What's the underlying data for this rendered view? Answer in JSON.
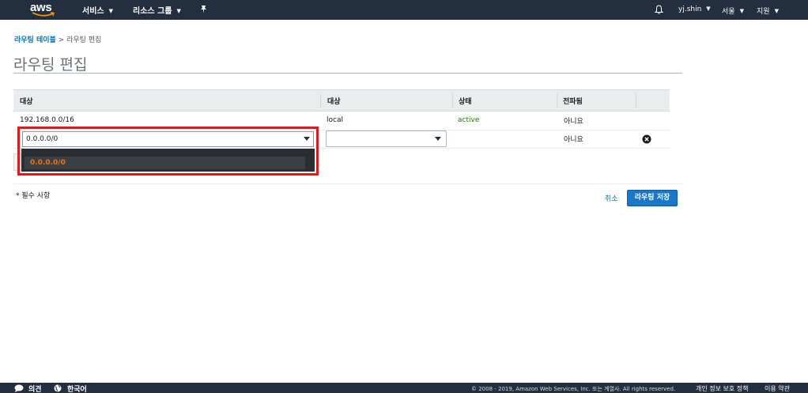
{
  "topnav": {
    "logo": "aws",
    "services": "서비스",
    "resource_groups": "리소스 그룹",
    "pin_icon": "pin-icon",
    "bell_icon": "bell-icon",
    "user": "yj.shin",
    "region": "서울",
    "support": "지원"
  },
  "breadcrumb": {
    "parent": "라우팅 테이블",
    "separator": ">",
    "current": "라우팅 편집"
  },
  "page": {
    "title": "라우팅 편집"
  },
  "table": {
    "headers": [
      "대상",
      "대상",
      "상태",
      "전파됨"
    ],
    "rows": [
      {
        "destination": "192.168.0.0/16",
        "target": "local",
        "status": "active",
        "propagated": "아니요"
      },
      {
        "destination": "0.0.0.0/0",
        "target": "",
        "status": "",
        "propagated": "아니요"
      }
    ]
  },
  "dropdown": {
    "option": "0.0.0.0/0"
  },
  "form": {
    "required_note": "* 필수 사항",
    "cancel": "취소",
    "save": "라우팅 저장"
  },
  "footer": {
    "feedback": "의견",
    "language": "한국어",
    "copyright": "© 2008 - 2019, Amazon Web Services, Inc. 또는 계열사. All rights reserved.",
    "privacy": "개인 정보 보호 정책",
    "terms": "이용 약관"
  },
  "colors": {
    "nav_bg": "#232f3e",
    "link": "#0073bb",
    "active": "#1d8102",
    "highlight": "#e3181a",
    "option_text": "#ec7211",
    "primary_button": "#1b78c9"
  }
}
